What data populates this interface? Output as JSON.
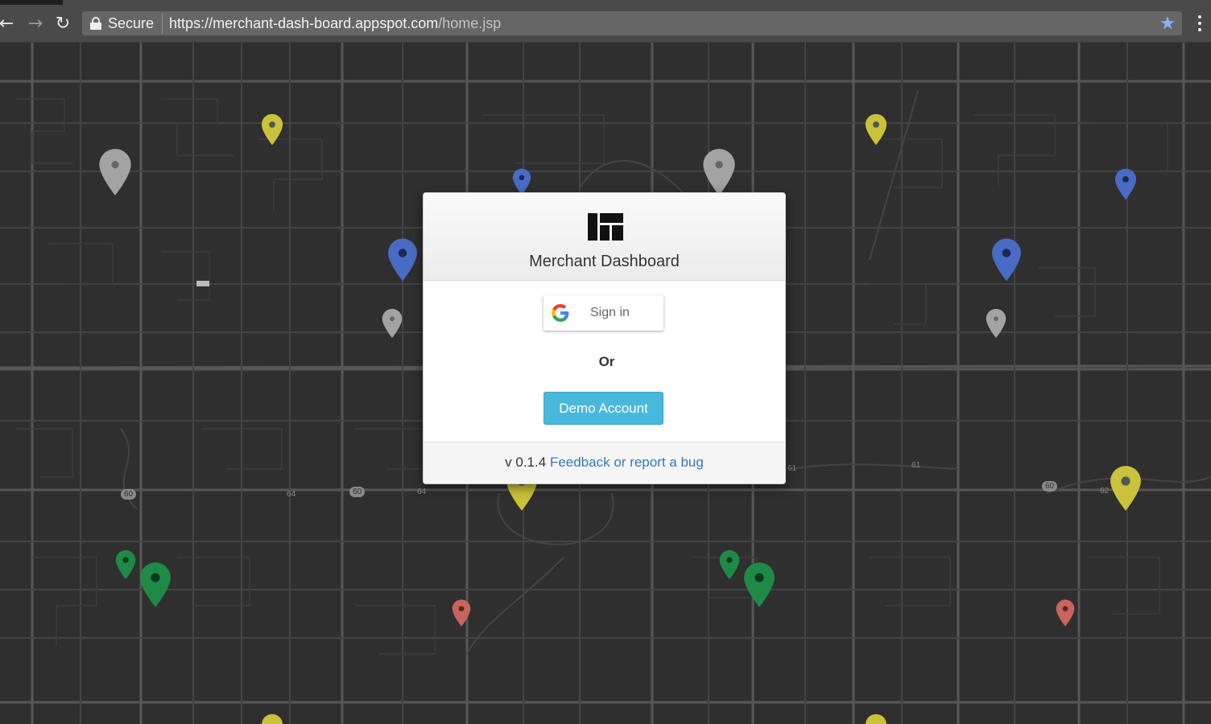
{
  "browser": {
    "security_label": "Secure",
    "url_main": "https://merchant-dash-board.appspot.com",
    "url_path": "/home.jsp"
  },
  "modal": {
    "title": "Merchant Dashboard",
    "google_signin_label": "Sign in",
    "or_label": "Or",
    "demo_button_label": "Demo Account",
    "version": "v 0.1.4",
    "feedback_link": "Feedback or report a bug"
  },
  "map": {
    "road_shields": [
      "60",
      "64",
      "60",
      "64",
      "61",
      "61",
      "60",
      "62"
    ]
  },
  "colors": {
    "pin_yellow": "#c9c23a",
    "pin_gray": "#a3a3a3",
    "pin_blue": "#4a6bc4",
    "pin_green": "#1e8a46",
    "pin_red": "#c7645e",
    "demo_button": "#48b8dc",
    "link": "#337ab7"
  }
}
